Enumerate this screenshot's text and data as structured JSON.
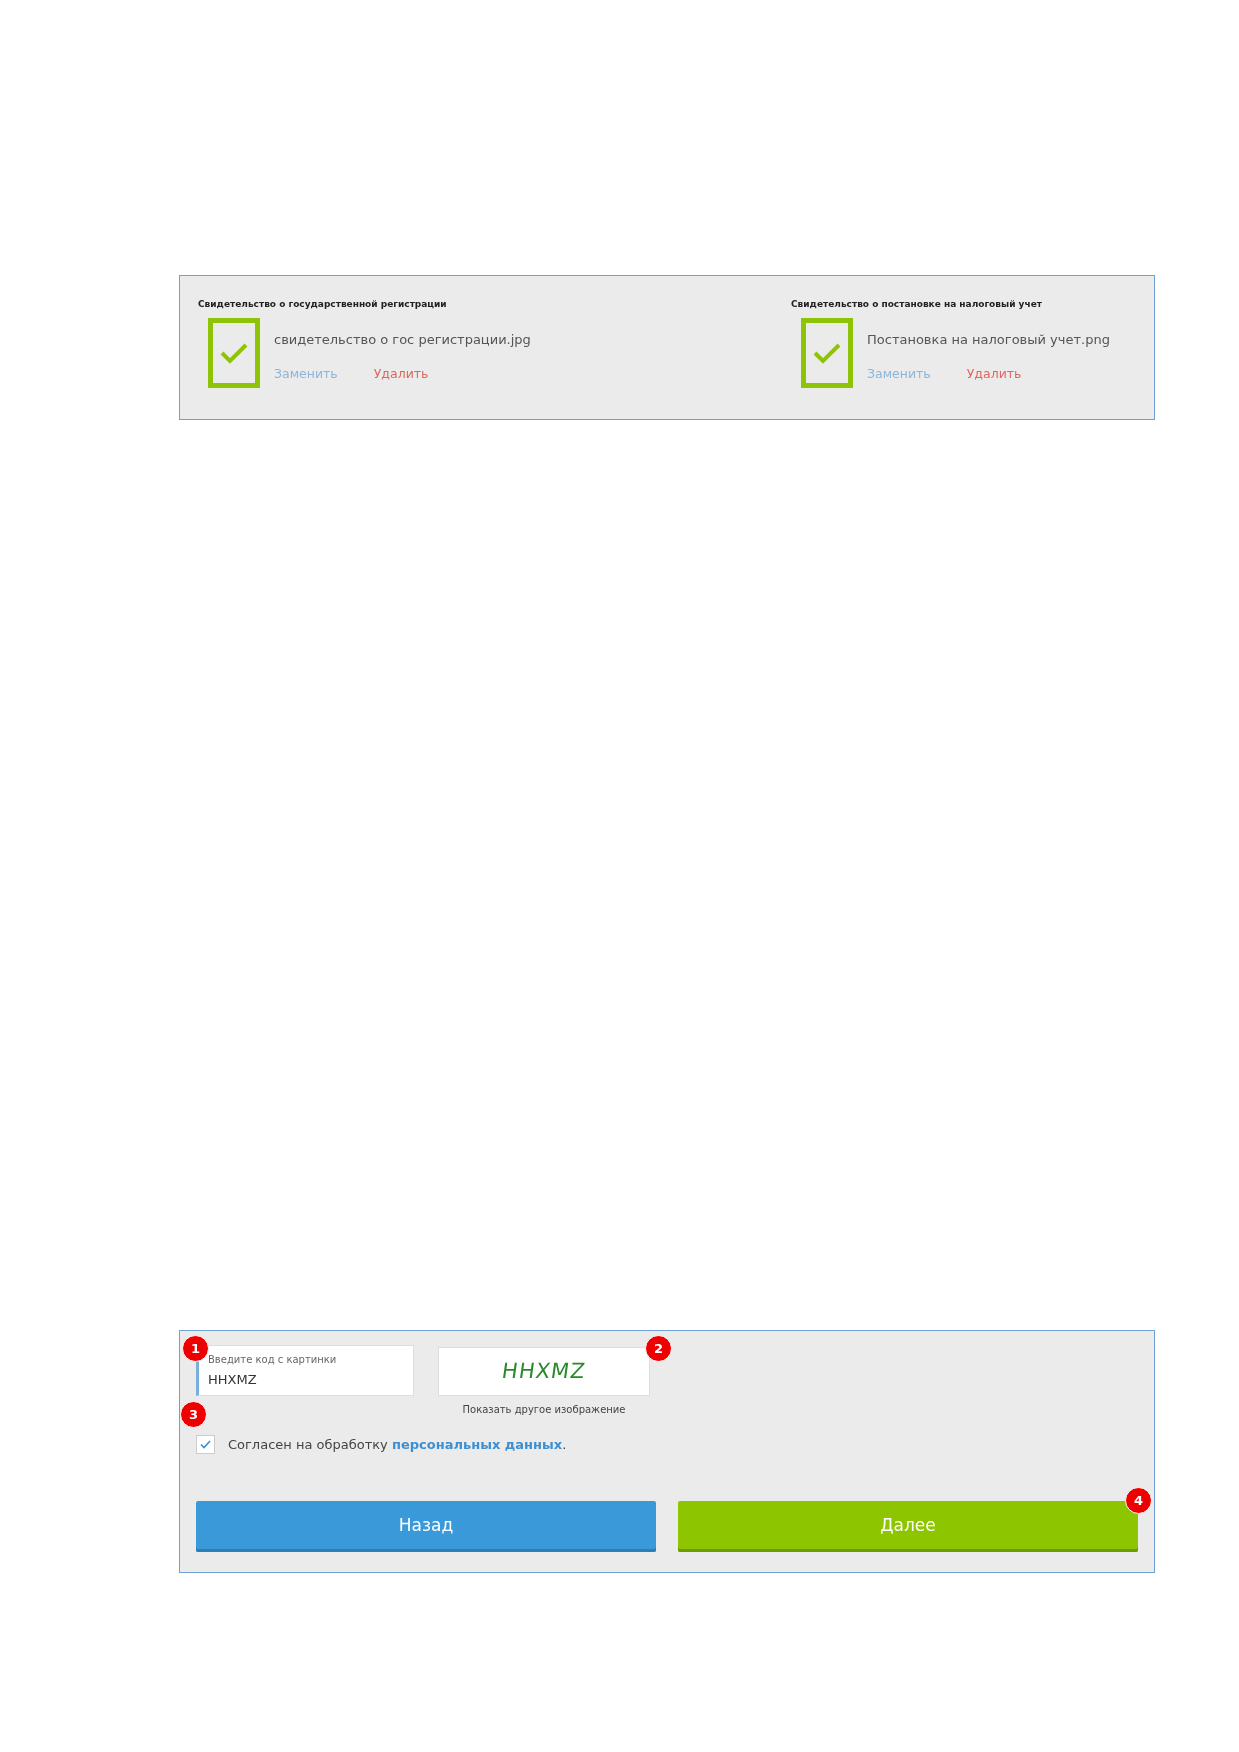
{
  "documents": [
    {
      "title": "Свидетельство о государственной регистрации",
      "uploaded": true,
      "file": "свидетельство о гос регистрации.jpg",
      "replace": "Заменить",
      "delete": "Удалить"
    },
    {
      "title": "Свидетельство о постановке на налоговый учет",
      "uploaded": true,
      "file": "Постановка на налоговый учет.png",
      "replace": "Заменить",
      "delete": "Удалить"
    }
  ],
  "captcha": {
    "label": "Введите код с картинки",
    "value": "HHXMZ",
    "image_text": "HHXMZ",
    "refresh": "Показать другое изображение"
  },
  "consent": {
    "checked": true,
    "text": "Согласен на обработку ",
    "link": "персональных данных",
    "end": "."
  },
  "buttons": [
    {
      "kind": "back",
      "label": "Назад"
    },
    {
      "kind": "next",
      "label": "Далее"
    }
  ],
  "markers": [
    "1",
    "2",
    "3",
    "4"
  ]
}
